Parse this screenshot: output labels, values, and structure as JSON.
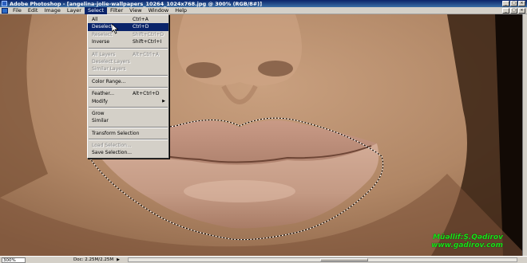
{
  "window": {
    "title": "Adobe Photoshop - [angelina-jolie-wallpapers_10264_1024x768.jpg @ 300% (RGB/8#)]",
    "min_label": "_",
    "max_label": "□",
    "close_label": "×"
  },
  "menubar": {
    "items": [
      "File",
      "Edit",
      "Image",
      "Layer",
      "Select",
      "Filter",
      "View",
      "Window",
      "Help"
    ],
    "active": "Select"
  },
  "select_menu": {
    "groups": [
      [
        {
          "label": "All",
          "shortcut": "Ctrl+A",
          "state": "normal"
        },
        {
          "label": "Deselect",
          "shortcut": "Ctrl+D",
          "state": "highlight"
        },
        {
          "label": "Reselect",
          "shortcut": "Shift+Ctrl+D",
          "state": "disabled"
        },
        {
          "label": "Inverse",
          "shortcut": "Shift+Ctrl+I",
          "state": "normal"
        }
      ],
      [
        {
          "label": "All Layers",
          "shortcut": "Alt+Ctrl+A",
          "state": "disabled"
        },
        {
          "label": "Deselect Layers",
          "shortcut": "",
          "state": "disabled"
        },
        {
          "label": "Similar Layers",
          "shortcut": "",
          "state": "disabled"
        }
      ],
      [
        {
          "label": "Color Range...",
          "shortcut": "",
          "state": "normal"
        }
      ],
      [
        {
          "label": "Feather...",
          "shortcut": "Alt+Ctrl+D",
          "state": "normal"
        },
        {
          "label": "Modify",
          "shortcut": "",
          "state": "normal",
          "submenu": true
        }
      ],
      [
        {
          "label": "Grow",
          "shortcut": "",
          "state": "normal"
        },
        {
          "label": "Similar",
          "shortcut": "",
          "state": "normal"
        }
      ],
      [
        {
          "label": "Transform Selection",
          "shortcut": "",
          "state": "normal"
        }
      ],
      [
        {
          "label": "Load Selection...",
          "shortcut": "",
          "state": "disabled"
        },
        {
          "label": "Save Selection...",
          "shortcut": "",
          "state": "normal"
        }
      ]
    ]
  },
  "watermark": {
    "line1": "Müəllif:Ş.Qədirov",
    "line2": "www.gadirov.com",
    "color": "#19e219"
  },
  "statusbar": {
    "zoom": "300%",
    "doc": "Doc: 2.25M/2.25M"
  },
  "colors": {
    "menu_highlight": "#0a246a",
    "chrome": "#d4d0c8"
  }
}
